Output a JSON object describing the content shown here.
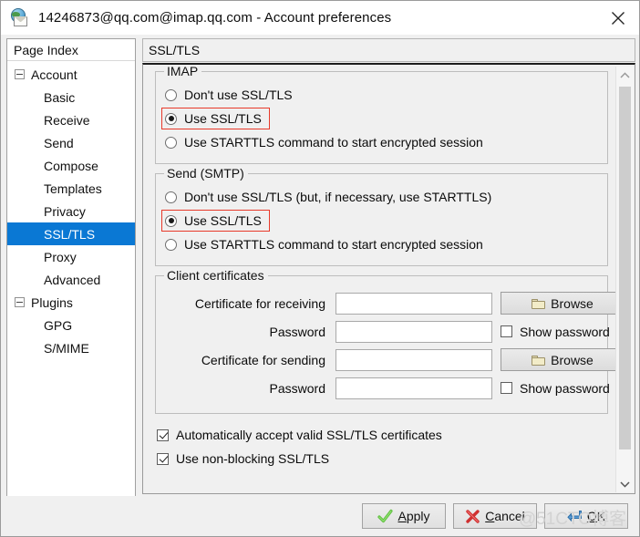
{
  "window": {
    "title": "14246873@qq.com@imap.qq.com - Account preferences",
    "icon": "mail-globe-icon",
    "close_label": "✕"
  },
  "sidebar": {
    "header": "Page Index",
    "items": [
      {
        "label": "Account",
        "type": "root",
        "expanded": true,
        "selected": false
      },
      {
        "label": "Basic",
        "type": "child",
        "selected": false
      },
      {
        "label": "Receive",
        "type": "child",
        "selected": false
      },
      {
        "label": "Send",
        "type": "child",
        "selected": false
      },
      {
        "label": "Compose",
        "type": "child",
        "selected": false
      },
      {
        "label": "Templates",
        "type": "child",
        "selected": false
      },
      {
        "label": "Privacy",
        "type": "child",
        "selected": false
      },
      {
        "label": "SSL/TLS",
        "type": "child",
        "selected": true
      },
      {
        "label": "Proxy",
        "type": "child",
        "selected": false
      },
      {
        "label": "Advanced",
        "type": "child",
        "selected": false
      },
      {
        "label": "Plugins",
        "type": "root",
        "expanded": true,
        "selected": false
      },
      {
        "label": "GPG",
        "type": "child",
        "selected": false
      },
      {
        "label": "S/MIME",
        "type": "child",
        "selected": false
      }
    ]
  },
  "page": {
    "title": "SSL/TLS",
    "imap_group": {
      "title": "IMAP",
      "options": [
        {
          "label": "Don't use SSL/TLS",
          "selected": false,
          "highlighted": false
        },
        {
          "label": "Use SSL/TLS",
          "selected": true,
          "highlighted": true
        },
        {
          "label": "Use STARTTLS command to start encrypted session",
          "selected": false,
          "highlighted": false
        }
      ]
    },
    "smtp_group": {
      "title": "Send (SMTP)",
      "options": [
        {
          "label": "Don't use SSL/TLS (but, if necessary, use STARTTLS)",
          "selected": false,
          "highlighted": false
        },
        {
          "label": "Use SSL/TLS",
          "selected": true,
          "highlighted": true
        },
        {
          "label": "Use STARTTLS command to start encrypted session",
          "selected": false,
          "highlighted": false
        }
      ]
    },
    "cert_group": {
      "title": "Client certificates",
      "rows": [
        {
          "label": "Certificate for receiving",
          "value": "",
          "action": "browse",
          "action_label": "Browse"
        },
        {
          "label": "Password",
          "value": "",
          "action": "checkbox",
          "action_label": "Show password",
          "checked": false
        },
        {
          "label": "Certificate for sending",
          "value": "",
          "action": "browse",
          "action_label": "Browse"
        },
        {
          "label": "Password",
          "value": "",
          "action": "checkbox",
          "action_label": "Show password",
          "checked": false
        }
      ]
    },
    "bottom_checks": [
      {
        "label": "Automatically accept valid SSL/TLS certificates",
        "checked": true
      },
      {
        "label": "Use non-blocking SSL/TLS",
        "checked": true
      }
    ]
  },
  "buttons": {
    "apply": {
      "label_pre": "",
      "accel": "A",
      "label_post": "pply",
      "icon": "green-check-icon"
    },
    "cancel": {
      "label_pre": "",
      "accel": "C",
      "label_post": "ancel",
      "icon": "red-x-icon"
    },
    "ok": {
      "label_pre": "",
      "accel": "O",
      "label_post": "K",
      "icon": "blue-enter-icon"
    }
  },
  "watermark": "@51CTO博客",
  "colors": {
    "selection": "#0a78d4",
    "highlight_box": "#e8392a",
    "window_bg": "#f0f0f0"
  }
}
